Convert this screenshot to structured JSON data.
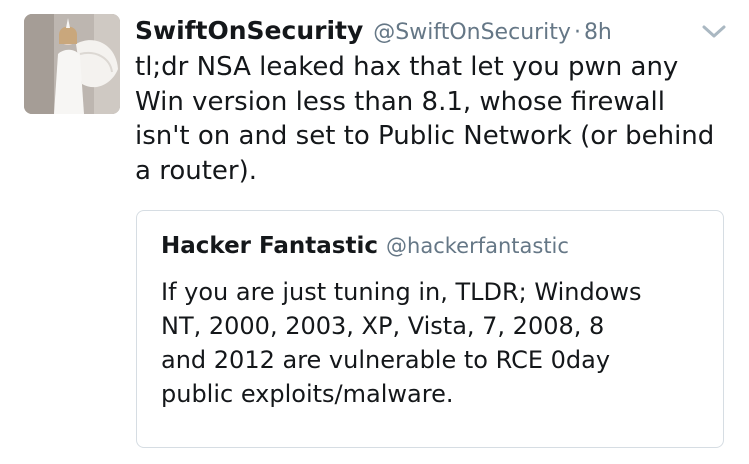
{
  "tweet": {
    "display_name": "SwiftOnSecurity",
    "handle": "@SwiftOnSecurity",
    "separator": "·",
    "time": "8h",
    "text_lines": [
      "tl;dr NSA leaked hax that let you pwn any",
      "Win version less than 8.1, whose firewall",
      "isn't on and set to Public Network (or behind",
      "a router)."
    ]
  },
  "quoted_tweet": {
    "display_name": "Hacker Fantastic",
    "handle": "@hackerfantastic",
    "text_lines": [
      "If you are just tuning in, TLDR; Windows",
      "NT, 2000, 2003, XP, Vista, 7, 2008, 8",
      "and 2012 are vulnerable to RCE 0day",
      "public exploits/malware."
    ]
  },
  "icons": {
    "avatar": "avatar-photo",
    "menu": "chevron-down-icon"
  },
  "colors": {
    "text": "#14171a",
    "secondary_text": "#657786",
    "border": "#d6dde3",
    "caret": "#aab8c2"
  }
}
